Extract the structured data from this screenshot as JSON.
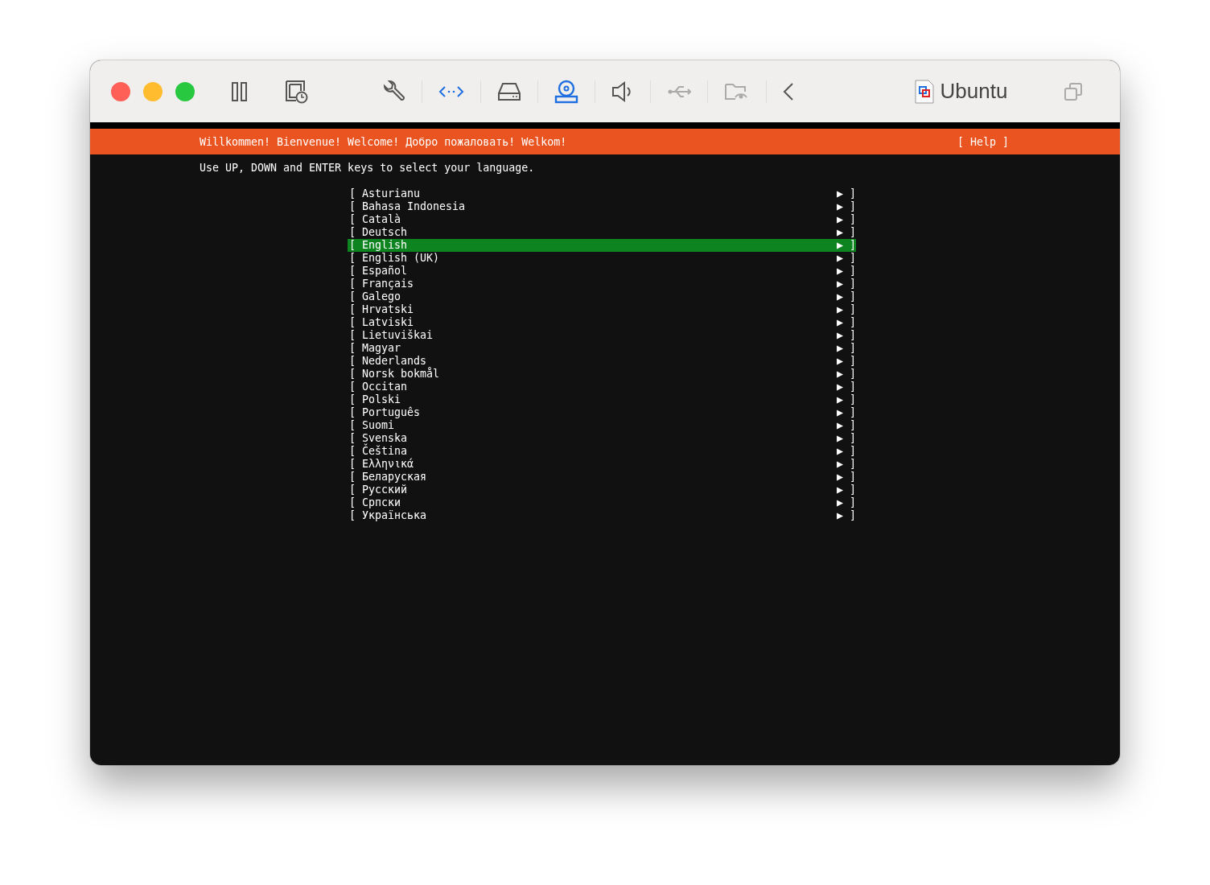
{
  "window": {
    "title": "Ubuntu"
  },
  "header": {
    "welcome": "Willkommen! Bienvenue! Welcome! Добро пожаловать! Welkom!",
    "help": "[ Help ]"
  },
  "instruction": "Use UP, DOWN and ENTER keys to select your language.",
  "languages": [
    {
      "label": "[ Asturianu",
      "end": "▶ ]",
      "selected": false
    },
    {
      "label": "[ Bahasa Indonesia",
      "end": "▶ ]",
      "selected": false
    },
    {
      "label": "[ Català",
      "end": "▶ ]",
      "selected": false
    },
    {
      "label": "[ Deutsch",
      "end": "▶ ]",
      "selected": false
    },
    {
      "label": "[ English",
      "end": "▶ ]",
      "selected": true
    },
    {
      "label": "[ English (UK)",
      "end": "▶ ]",
      "selected": false
    },
    {
      "label": "[ Español",
      "end": "▶ ]",
      "selected": false
    },
    {
      "label": "[ Français",
      "end": "▶ ]",
      "selected": false
    },
    {
      "label": "[ Galego",
      "end": "▶ ]",
      "selected": false
    },
    {
      "label": "[ Hrvatski",
      "end": "▶ ]",
      "selected": false
    },
    {
      "label": "[ Latviski",
      "end": "▶ ]",
      "selected": false
    },
    {
      "label": "[ Lietuviškai",
      "end": "▶ ]",
      "selected": false
    },
    {
      "label": "[ Magyar",
      "end": "▶ ]",
      "selected": false
    },
    {
      "label": "[ Nederlands",
      "end": "▶ ]",
      "selected": false
    },
    {
      "label": "[ Norsk bokmål",
      "end": "▶ ]",
      "selected": false
    },
    {
      "label": "[ Occitan",
      "end": "▶ ]",
      "selected": false
    },
    {
      "label": "[ Polski",
      "end": "▶ ]",
      "selected": false
    },
    {
      "label": "[ Português",
      "end": "▶ ]",
      "selected": false
    },
    {
      "label": "[ Suomi",
      "end": "▶ ]",
      "selected": false
    },
    {
      "label": "[ Svenska",
      "end": "▶ ]",
      "selected": false
    },
    {
      "label": "[ Čeština",
      "end": "▶ ]",
      "selected": false
    },
    {
      "label": "[ Ελληνικά",
      "end": "▶ ]",
      "selected": false
    },
    {
      "label": "[ Беларуская",
      "end": "▶ ]",
      "selected": false
    },
    {
      "label": "[ Русский",
      "end": "▶ ]",
      "selected": false
    },
    {
      "label": "[ Српски",
      "end": "▶ ]",
      "selected": false
    },
    {
      "label": "[ Українська",
      "end": "▶ ]",
      "selected": false
    }
  ]
}
